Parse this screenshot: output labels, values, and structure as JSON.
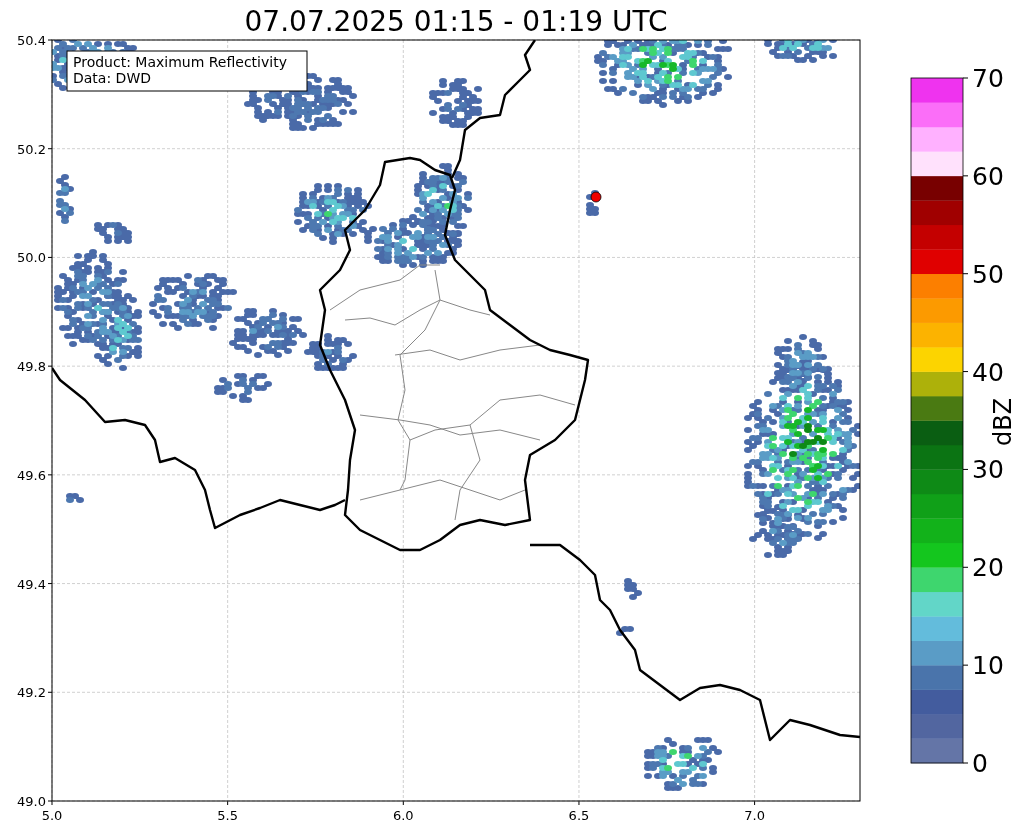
{
  "title": "07.07.2025 01:15 - 01:19 UTC",
  "info_box": {
    "lines": [
      "Product: Maximum Reflectivity",
      "Data: DWD"
    ]
  },
  "map": {
    "xticks": [
      "5.0",
      "5.5",
      "6.0",
      "6.5",
      "7.0"
    ],
    "yticks": [
      "50.4",
      "50.2",
      "50.0",
      "49.8",
      "49.6",
      "49.4",
      "49.2",
      "49.0"
    ]
  },
  "colorbar": {
    "label": "dBZ",
    "ticks": [
      "70",
      "60",
      "50",
      "40",
      "30",
      "20",
      "10",
      "0"
    ],
    "bands": [
      {
        "color": "#6475a7"
      },
      {
        "color": "#5266a0"
      },
      {
        "color": "#435c9e"
      },
      {
        "color": "#4a74ab"
      },
      {
        "color": "#5a9cc6"
      },
      {
        "color": "#63bcdc"
      },
      {
        "color": "#62d6c8"
      },
      {
        "color": "#3ed66e"
      },
      {
        "color": "#14c61e"
      },
      {
        "color": "#12b21a"
      },
      {
        "color": "#10a018"
      },
      {
        "color": "#0e8a16"
      },
      {
        "color": "#0b7413"
      },
      {
        "color": "#0a5e12"
      },
      {
        "color": "#4a7a12"
      },
      {
        "color": "#adb10a"
      },
      {
        "color": "#fcd400"
      },
      {
        "color": "#fcb300"
      },
      {
        "color": "#fc9a00"
      },
      {
        "color": "#fc7f00"
      },
      {
        "color": "#e00000"
      },
      {
        "color": "#c40000"
      },
      {
        "color": "#a00000"
      },
      {
        "color": "#780000"
      },
      {
        "color": "#ffe1fc"
      },
      {
        "color": "#ffb1ff"
      },
      {
        "color": "#fb6ef8"
      },
      {
        "color": "#ef33ef"
      }
    ]
  }
}
